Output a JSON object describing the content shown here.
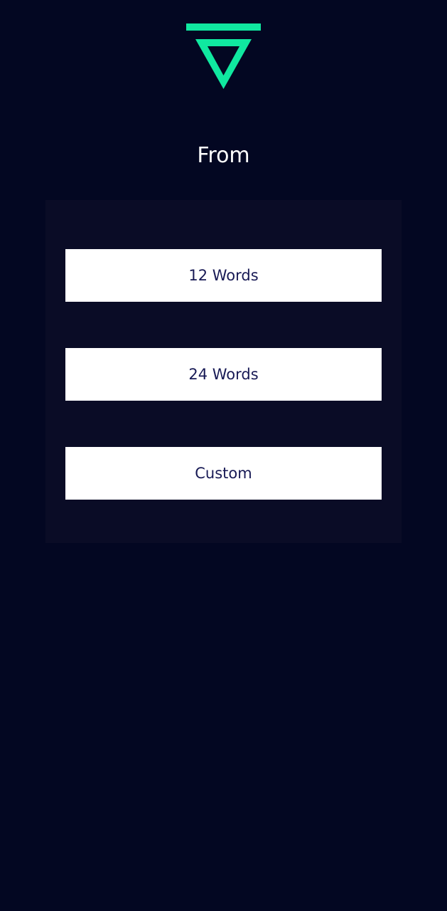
{
  "brand": {
    "logo_icon": "inverted-triangle-logo-icon",
    "accent_color": "#10e8a0"
  },
  "screen": {
    "title": "From",
    "background_color": "#030722"
  },
  "options": [
    {
      "label": "12 Words"
    },
    {
      "label": "24 Words"
    },
    {
      "label": "Custom"
    }
  ],
  "colors": {
    "panel": "#0a0c26",
    "button_background": "#ffffff",
    "button_text": "#181a55",
    "title_text": "#ffffff"
  }
}
